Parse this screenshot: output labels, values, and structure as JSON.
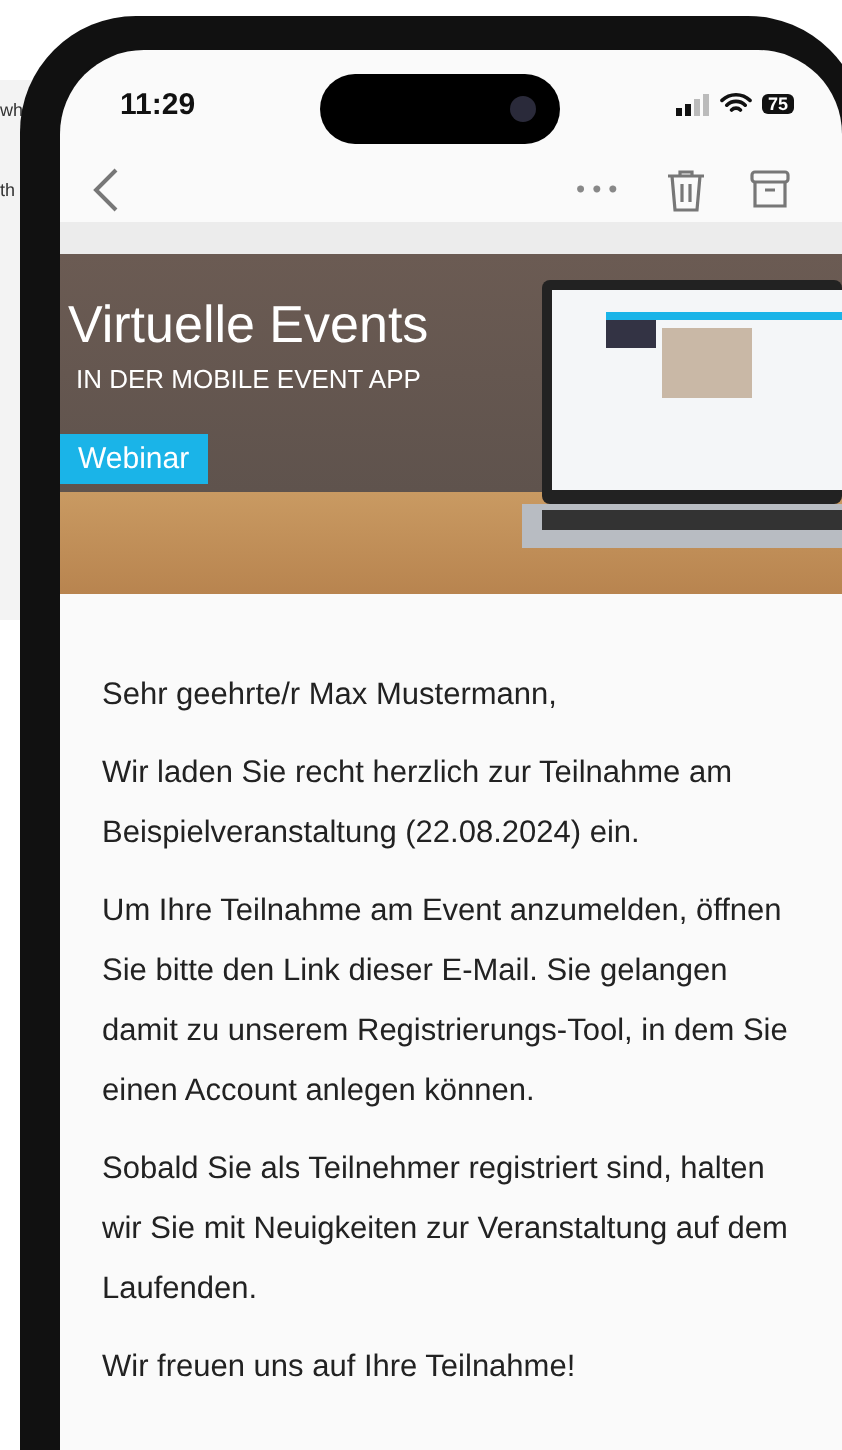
{
  "background_fragments": [
    "wh",
    "th"
  ],
  "status_bar": {
    "time": "11:29",
    "battery": "75"
  },
  "toolbar": {
    "more": "•••"
  },
  "banner": {
    "title": "Virtuelle Events",
    "subtitle": "IN DER MOBILE EVENT APP",
    "tag": "Webinar"
  },
  "email": {
    "greeting": "Sehr geehrte/r Max Mustermann,",
    "paragraphs": [
      "Wir laden Sie recht herzlich zur Teilnahme am Beispielveranstaltung (22.08.2024) ein.",
      "Um Ihre Teilnahme am Event anzumelden, öffnen Sie bitte den Link dieser E-Mail. Sie gelangen damit zu unserem Registrierungs-Tool, in dem Sie einen Account anlegen können.",
      "Sobald Sie als Teilnehmer registriert sind, halten wir Sie mit Neuigkeiten zur Veranstaltung auf dem Laufenden.",
      "Wir freuen uns auf Ihre Teilnahme!"
    ]
  }
}
